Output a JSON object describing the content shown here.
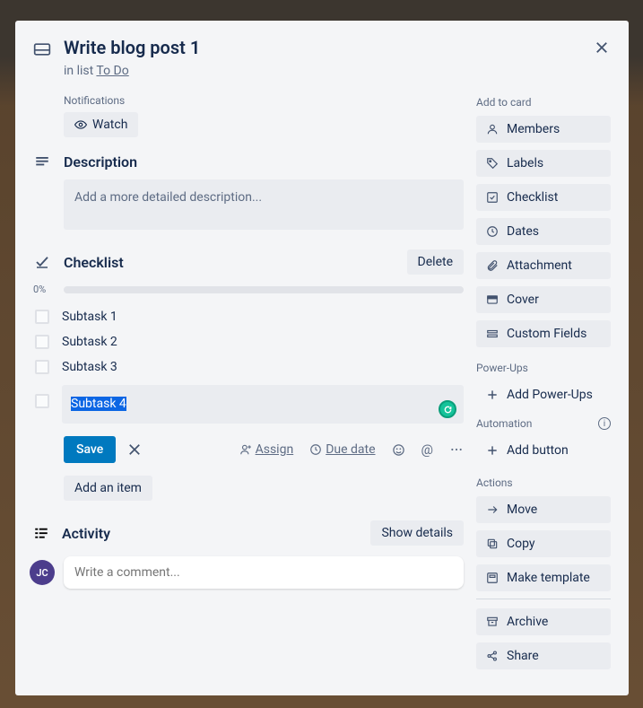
{
  "card": {
    "title": "Write blog post 1",
    "in_list_prefix": "in list ",
    "list_name": "To Do"
  },
  "notifications": {
    "label": "Notifications",
    "watch": "Watch"
  },
  "description": {
    "heading": "Description",
    "placeholder": "Add a more detailed description..."
  },
  "checklist": {
    "heading": "Checklist",
    "delete": "Delete",
    "percent": "0%",
    "items": [
      {
        "label": "Subtask 1"
      },
      {
        "label": "Subtask 2"
      },
      {
        "label": "Subtask 3"
      }
    ],
    "editing": {
      "value": "Subtask 4",
      "save": "Save",
      "assign": "Assign",
      "due_date": "Due date"
    },
    "add_item": "Add an item"
  },
  "activity": {
    "heading": "Activity",
    "show_details": "Show details",
    "avatar_initials": "JC",
    "comment_placeholder": "Write a comment..."
  },
  "sidebar": {
    "add_to_card": "Add to card",
    "members": "Members",
    "labels": "Labels",
    "checklist": "Checklist",
    "dates": "Dates",
    "attachment": "Attachment",
    "cover": "Cover",
    "custom_fields": "Custom Fields",
    "powerups_label": "Power-Ups",
    "add_powerups": "Add Power-Ups",
    "automation_label": "Automation",
    "add_button": "Add button",
    "actions_label": "Actions",
    "move": "Move",
    "copy": "Copy",
    "make_template": "Make template",
    "archive": "Archive",
    "share": "Share"
  }
}
